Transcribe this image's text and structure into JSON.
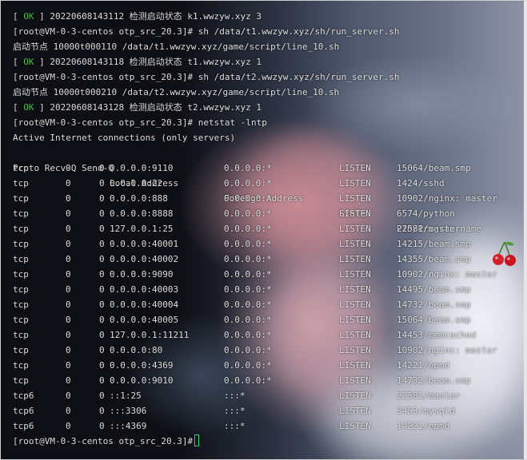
{
  "intro": [
    {
      "type": "ok",
      "open": "[ ",
      "status": "OK",
      "close": " ]",
      "text": " 20220608143112 检测启动状态 k1.wwzyw.xyz 3"
    },
    {
      "type": "plain",
      "text": "[root@VM-0-3-centos otp_src_20.3]# sh /data/t1.wwzyw.xyz/sh/run_server.sh"
    },
    {
      "type": "plain",
      "text": "启动节点 10000t000110 /data/t1.wwzyw.xyz/game/script/line_10.sh"
    },
    {
      "type": "ok",
      "open": "[ ",
      "status": "OK",
      "close": " ]",
      "text": " 20220608143118 检测启动状态 t1.wwzyw.xyz 1"
    },
    {
      "type": "plain",
      "text": "[root@VM-0-3-centos otp_src_20.3]# sh /data/t2.wwzyw.xyz/sh/run_server.sh"
    },
    {
      "type": "plain",
      "text": "启动节点 10000t000210 /data/t2.wwzyw.xyz/game/script/line_10.sh"
    },
    {
      "type": "ok",
      "open": "[ ",
      "status": "OK",
      "close": " ]",
      "text": " 20220608143128 检测启动状态 t2.wwzyw.xyz 1"
    },
    {
      "type": "plain",
      "text": "[root@VM-0-3-centos otp_src_20.3]# netstat -lntp"
    },
    {
      "type": "plain",
      "text": "Active Internet connections (only servers)"
    }
  ],
  "table": {
    "headers": {
      "proto_recv_send": "Proto Recv-Q Send-Q",
      "local": "Local Address",
      "foreign": "Foreign Address",
      "state": "State",
      "pid": "PID/Program name"
    },
    "rows": [
      {
        "proto": "tcp",
        "recv": "0",
        "send": "0",
        "local": "0.0.0.0:9110",
        "foreign": "0.0.0.0:*",
        "state": "LISTEN",
        "pid": "15064/beam.smp"
      },
      {
        "proto": "tcp",
        "recv": "0",
        "send": "0",
        "local": "0.0.0.0:22",
        "foreign": "0.0.0.0:*",
        "state": "LISTEN",
        "pid": "1424/sshd"
      },
      {
        "proto": "tcp",
        "recv": "0",
        "send": "0",
        "local": "0.0.0.0:888",
        "foreign": "0.0.0.0:*",
        "state": "LISTEN",
        "pid": "10902/nginx: master"
      },
      {
        "proto": "tcp",
        "recv": "0",
        "send": "0",
        "local": "0.0.0.0:8888",
        "foreign": "0.0.0.0:*",
        "state": "LISTEN",
        "pid": "6574/python"
      },
      {
        "proto": "tcp",
        "recv": "0",
        "send": "0",
        "local": "127.0.0.1:25",
        "foreign": "0.0.0.0:*",
        "state": "LISTEN",
        "pid": "22581/master"
      },
      {
        "proto": "tcp",
        "recv": "0",
        "send": "0",
        "local": "0.0.0.0:40001",
        "foreign": "0.0.0.0:*",
        "state": "LISTEN",
        "pid": "14215/beam.smp"
      },
      {
        "proto": "tcp",
        "recv": "0",
        "send": "0",
        "local": "0.0.0.0:40002",
        "foreign": "0.0.0.0:*",
        "state": "LISTEN",
        "pid": "14355/beam.smp"
      },
      {
        "proto": "tcp",
        "recv": "0",
        "send": "0",
        "local": "0.0.0.0:9090",
        "foreign": "0.0.0.0:*",
        "state": "LISTEN",
        "pid": "10902/nginx: master"
      },
      {
        "proto": "tcp",
        "recv": "0",
        "send": "0",
        "local": "0.0.0.0:40003",
        "foreign": "0.0.0.0:*",
        "state": "LISTEN",
        "pid": "14495/beam.smp"
      },
      {
        "proto": "tcp",
        "recv": "0",
        "send": "0",
        "local": "0.0.0.0:40004",
        "foreign": "0.0.0.0:*",
        "state": "LISTEN",
        "pid": "14732/beam.smp"
      },
      {
        "proto": "tcp",
        "recv": "0",
        "send": "0",
        "local": "0.0.0.0:40005",
        "foreign": "0.0.0.0:*",
        "state": "LISTEN",
        "pid": "15064/beam.smp"
      },
      {
        "proto": "tcp",
        "recv": "0",
        "send": "0",
        "local": "127.0.0.1:11211",
        "foreign": "0.0.0.0:*",
        "state": "LISTEN",
        "pid": "14453/memcached"
      },
      {
        "proto": "tcp",
        "recv": "0",
        "send": "0",
        "local": "0.0.0.0:80",
        "foreign": "0.0.0.0:*",
        "state": "LISTEN",
        "pid": "10902/nginx: master"
      },
      {
        "proto": "tcp",
        "recv": "0",
        "send": "0",
        "local": "0.0.0.0:4369",
        "foreign": "0.0.0.0:*",
        "state": "LISTEN",
        "pid": "14221/epmd"
      },
      {
        "proto": "tcp",
        "recv": "0",
        "send": "0",
        "local": "0.0.0.0:9010",
        "foreign": "0.0.0.0:*",
        "state": "LISTEN",
        "pid": "14732/beam.smp"
      },
      {
        "proto": "tcp6",
        "recv": "0",
        "send": "0",
        "local": "::1:25",
        "foreign": ":::*",
        "state": "LISTEN",
        "pid": "22581/master"
      },
      {
        "proto": "tcp6",
        "recv": "0",
        "send": "0",
        "local": ":::3306",
        "foreign": ":::*",
        "state": "LISTEN",
        "pid": "3453/mysqld"
      },
      {
        "proto": "tcp6",
        "recv": "0",
        "send": "0",
        "local": ":::4369",
        "foreign": ":::*",
        "state": "LISTEN",
        "pid": "14221/epmd"
      }
    ]
  },
  "prompt": "[root@VM-0-3-centos otp_src_20.3]#",
  "colors": {
    "text": "#dedede",
    "ok": "#3fc13f",
    "cursor": "#1fd07a"
  },
  "icons": {
    "cursor": "block-cursor",
    "sticker": "cherry-icon"
  }
}
